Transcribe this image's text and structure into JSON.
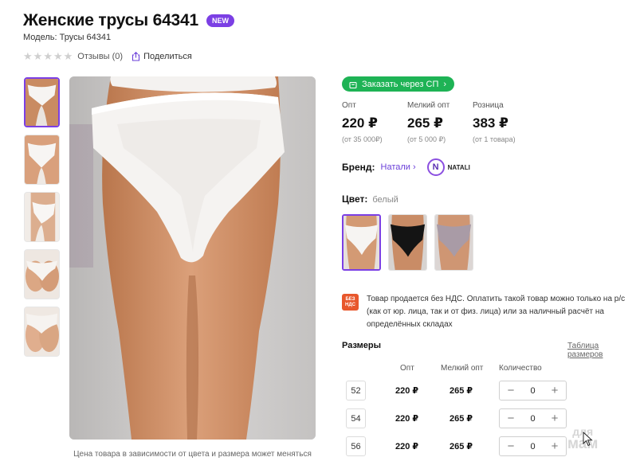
{
  "product": {
    "title": "Женские трусы 64341",
    "badge": "NEW",
    "model": "Модель: Трусы 64341"
  },
  "rating": {
    "stars": 0,
    "max_stars": 5,
    "reviews": "Отзывы (0)",
    "share": "Поделиться"
  },
  "gallery": {
    "thumbnail_count": 5,
    "active_index": 0,
    "caption": "Цена товара в зависимости от цвета и размера может меняться"
  },
  "order_button": "Заказать через СП",
  "prices": [
    {
      "label": "Опт",
      "value": "220 ₽",
      "note": "(от 35 000₽)"
    },
    {
      "label": "Мелкий опт",
      "value": "265 ₽",
      "note": "(от 5 000 ₽)"
    },
    {
      "label": "Розница",
      "value": "383 ₽",
      "note": "(от 1 товара)"
    }
  ],
  "brand": {
    "label": "Бренд:",
    "link": "Натали",
    "logo_letter": "N",
    "logo_text": "NATALI"
  },
  "color": {
    "label": "Цвет:",
    "value": "белый",
    "swatches": [
      "white",
      "black",
      "grey"
    ],
    "active_index": 0
  },
  "vat": {
    "icon_text_1": "БЕЗ",
    "icon_text_2": "НДС",
    "text": "Товар продается без НДС. Оплатить такой товар можно только на р/с (как от юр. лица, так и от физ. лица) или за наличный расчёт на определённых складах"
  },
  "sizes": {
    "title": "Размеры",
    "table_link": "Таблица размеров",
    "headers": {
      "opt": "Опт",
      "small_opt": "Мелкий опт",
      "qty": "Количество"
    },
    "rows": [
      {
        "size": "52",
        "opt": "220 ₽",
        "small_opt": "265 ₽",
        "qty": "0"
      },
      {
        "size": "54",
        "opt": "220 ₽",
        "small_opt": "265 ₽",
        "qty": "0"
      },
      {
        "size": "56",
        "opt": "220 ₽",
        "small_opt": "265 ₽",
        "qty": "0"
      }
    ]
  },
  "watermark": {
    "line1": "для",
    "line2": "мам"
  },
  "colors": {
    "accent": "#7b3fe4",
    "sp_button": "#1eb355",
    "vat_icon": "#e8572c",
    "brand_link": "#6a3fd9"
  }
}
